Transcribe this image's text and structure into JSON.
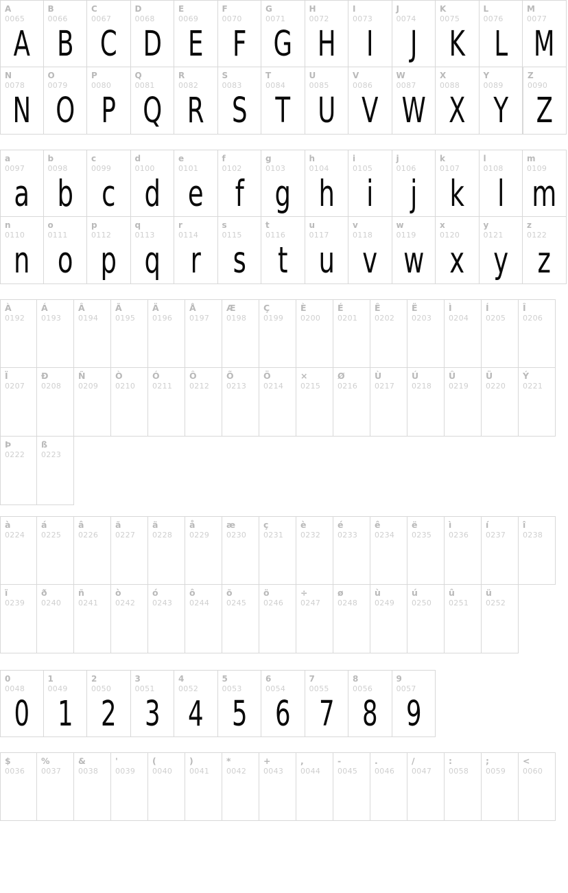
{
  "page": {
    "kind": "font-character-map",
    "background": "#ffffff",
    "grid_line_color": "#d8d8d8",
    "label_color": "#b9b9b9",
    "code_color": "#cfcfcf",
    "glyph_color": "#0a0a0a"
  },
  "sections": [
    {
      "id": "uppercase",
      "cell_style": "wide",
      "rows": [
        [
          {
            "ch": "A",
            "code": "0065",
            "rendered": true
          },
          {
            "ch": "B",
            "code": "0066",
            "rendered": true
          },
          {
            "ch": "C",
            "code": "0067",
            "rendered": true
          },
          {
            "ch": "D",
            "code": "0068",
            "rendered": true
          },
          {
            "ch": "E",
            "code": "0069",
            "rendered": true
          },
          {
            "ch": "F",
            "code": "0070",
            "rendered": true
          },
          {
            "ch": "G",
            "code": "0071",
            "rendered": true
          },
          {
            "ch": "H",
            "code": "0072",
            "rendered": true
          },
          {
            "ch": "I",
            "code": "0073",
            "rendered": true
          },
          {
            "ch": "J",
            "code": "0074",
            "rendered": true
          },
          {
            "ch": "K",
            "code": "0075",
            "rendered": true
          },
          {
            "ch": "L",
            "code": "0076",
            "rendered": true
          },
          {
            "ch": "M",
            "code": "0077",
            "rendered": true
          }
        ],
        [
          {
            "ch": "N",
            "code": "0078",
            "rendered": true
          },
          {
            "ch": "O",
            "code": "0079",
            "rendered": true
          },
          {
            "ch": "P",
            "code": "0080",
            "rendered": true
          },
          {
            "ch": "Q",
            "code": "0081",
            "rendered": true
          },
          {
            "ch": "R",
            "code": "0082",
            "rendered": true
          },
          {
            "ch": "S",
            "code": "0083",
            "rendered": true
          },
          {
            "ch": "T",
            "code": "0084",
            "rendered": true
          },
          {
            "ch": "U",
            "code": "0085",
            "rendered": true
          },
          {
            "ch": "V",
            "code": "0086",
            "rendered": true
          },
          {
            "ch": "W",
            "code": "0087",
            "rendered": true
          },
          {
            "ch": "X",
            "code": "0088",
            "rendered": true
          },
          {
            "ch": "Y",
            "code": "0089",
            "rendered": true
          }
        ],
        [
          {
            "ch": "Z",
            "code": "0090",
            "rendered": true
          }
        ]
      ]
    },
    {
      "id": "lowercase",
      "cell_style": "wide",
      "rows": [
        [
          {
            "ch": "a",
            "code": "0097",
            "rendered": true
          },
          {
            "ch": "b",
            "code": "0098",
            "rendered": true
          },
          {
            "ch": "c",
            "code": "0099",
            "rendered": true
          },
          {
            "ch": "d",
            "code": "0100",
            "rendered": true
          },
          {
            "ch": "e",
            "code": "0101",
            "rendered": true
          },
          {
            "ch": "f",
            "code": "0102",
            "rendered": true
          },
          {
            "ch": "g",
            "code": "0103",
            "rendered": true
          },
          {
            "ch": "h",
            "code": "0104",
            "rendered": true
          },
          {
            "ch": "i",
            "code": "0105",
            "rendered": true
          },
          {
            "ch": "j",
            "code": "0106",
            "rendered": true
          },
          {
            "ch": "k",
            "code": "0107",
            "rendered": true
          },
          {
            "ch": "l",
            "code": "0108",
            "rendered": true
          },
          {
            "ch": "m",
            "code": "0109",
            "rendered": true
          }
        ],
        [
          {
            "ch": "n",
            "code": "0110",
            "rendered": true
          },
          {
            "ch": "o",
            "code": "0111",
            "rendered": true
          },
          {
            "ch": "p",
            "code": "0112",
            "rendered": true
          },
          {
            "ch": "q",
            "code": "0113",
            "rendered": true
          },
          {
            "ch": "r",
            "code": "0114",
            "rendered": true
          },
          {
            "ch": "s",
            "code": "0115",
            "rendered": true
          },
          {
            "ch": "t",
            "code": "0116",
            "rendered": true
          },
          {
            "ch": "u",
            "code": "0117",
            "rendered": true
          },
          {
            "ch": "v",
            "code": "0118",
            "rendered": true
          },
          {
            "ch": "w",
            "code": "0119",
            "rendered": true
          },
          {
            "ch": "x",
            "code": "0120",
            "rendered": true
          },
          {
            "ch": "y",
            "code": "0121",
            "rendered": true
          },
          {
            "ch": "z",
            "code": "0122",
            "rendered": true
          }
        ]
      ]
    },
    {
      "id": "accented-uppercase",
      "cell_style": "narrow",
      "rows": [
        [
          {
            "ch": "À",
            "code": "0192",
            "rendered": false
          },
          {
            "ch": "Á",
            "code": "0193",
            "rendered": false
          },
          {
            "ch": "Â",
            "code": "0194",
            "rendered": false
          },
          {
            "ch": "Ã",
            "code": "0195",
            "rendered": false
          },
          {
            "ch": "Ä",
            "code": "0196",
            "rendered": false
          },
          {
            "ch": "Å",
            "code": "0197",
            "rendered": false
          },
          {
            "ch": "Æ",
            "code": "0198",
            "rendered": false
          },
          {
            "ch": "Ç",
            "code": "0199",
            "rendered": false
          },
          {
            "ch": "È",
            "code": "0200",
            "rendered": false
          },
          {
            "ch": "É",
            "code": "0201",
            "rendered": false
          },
          {
            "ch": "Ê",
            "code": "0202",
            "rendered": false
          },
          {
            "ch": "Ë",
            "code": "0203",
            "rendered": false
          },
          {
            "ch": "Ì",
            "code": "0204",
            "rendered": false
          },
          {
            "ch": "Í",
            "code": "0205",
            "rendered": false
          },
          {
            "ch": "Î",
            "code": "0206",
            "rendered": false
          }
        ],
        [
          {
            "ch": "Ï",
            "code": "0207",
            "rendered": false
          },
          {
            "ch": "Ð",
            "code": "0208",
            "rendered": false
          },
          {
            "ch": "Ñ",
            "code": "0209",
            "rendered": false
          },
          {
            "ch": "Ò",
            "code": "0210",
            "rendered": false
          },
          {
            "ch": "Ó",
            "code": "0211",
            "rendered": false
          },
          {
            "ch": "Ô",
            "code": "0212",
            "rendered": false
          },
          {
            "ch": "Õ",
            "code": "0213",
            "rendered": false
          },
          {
            "ch": "Ö",
            "code": "0214",
            "rendered": false
          },
          {
            "ch": "×",
            "code": "0215",
            "rendered": false
          },
          {
            "ch": "Ø",
            "code": "0216",
            "rendered": false
          },
          {
            "ch": "Ù",
            "code": "0217",
            "rendered": false
          },
          {
            "ch": "Ú",
            "code": "0218",
            "rendered": false
          },
          {
            "ch": "Û",
            "code": "0219",
            "rendered": false
          },
          {
            "ch": "Ü",
            "code": "0220",
            "rendered": false
          },
          {
            "ch": "Ý",
            "code": "0221",
            "rendered": false
          }
        ],
        [
          {
            "ch": "Þ",
            "code": "0222",
            "rendered": false
          },
          {
            "ch": "ß",
            "code": "0223",
            "rendered": false
          }
        ]
      ]
    },
    {
      "id": "accented-lowercase",
      "cell_style": "narrow",
      "rows": [
        [
          {
            "ch": "à",
            "code": "0224",
            "rendered": false
          },
          {
            "ch": "á",
            "code": "0225",
            "rendered": false
          },
          {
            "ch": "â",
            "code": "0226",
            "rendered": false
          },
          {
            "ch": "ã",
            "code": "0227",
            "rendered": false
          },
          {
            "ch": "ä",
            "code": "0228",
            "rendered": false
          },
          {
            "ch": "å",
            "code": "0229",
            "rendered": false
          },
          {
            "ch": "æ",
            "code": "0230",
            "rendered": false
          },
          {
            "ch": "ç",
            "code": "0231",
            "rendered": false
          },
          {
            "ch": "è",
            "code": "0232",
            "rendered": false
          },
          {
            "ch": "é",
            "code": "0233",
            "rendered": false
          },
          {
            "ch": "ê",
            "code": "0234",
            "rendered": false
          },
          {
            "ch": "ë",
            "code": "0235",
            "rendered": false
          },
          {
            "ch": "ì",
            "code": "0236",
            "rendered": false
          },
          {
            "ch": "í",
            "code": "0237",
            "rendered": false
          },
          {
            "ch": "î",
            "code": "0238",
            "rendered": false
          }
        ],
        [
          {
            "ch": "ï",
            "code": "0239",
            "rendered": false
          },
          {
            "ch": "ð",
            "code": "0240",
            "rendered": false
          },
          {
            "ch": "ñ",
            "code": "0241",
            "rendered": false
          },
          {
            "ch": "ò",
            "code": "0242",
            "rendered": false
          },
          {
            "ch": "ó",
            "code": "0243",
            "rendered": false
          },
          {
            "ch": "ô",
            "code": "0244",
            "rendered": false
          },
          {
            "ch": "õ",
            "code": "0245",
            "rendered": false
          },
          {
            "ch": "ö",
            "code": "0246",
            "rendered": false
          },
          {
            "ch": "÷",
            "code": "0247",
            "rendered": false
          },
          {
            "ch": "ø",
            "code": "0248",
            "rendered": false
          },
          {
            "ch": "ù",
            "code": "0249",
            "rendered": false
          },
          {
            "ch": "ú",
            "code": "0250",
            "rendered": false
          },
          {
            "ch": "û",
            "code": "0251",
            "rendered": false
          },
          {
            "ch": "ü",
            "code": "0252",
            "rendered": false
          }
        ]
      ]
    },
    {
      "id": "digits",
      "cell_style": "wide",
      "rows": [
        [
          {
            "ch": "0",
            "code": "0048",
            "rendered": true
          },
          {
            "ch": "1",
            "code": "0049",
            "rendered": true
          },
          {
            "ch": "2",
            "code": "0050",
            "rendered": true
          },
          {
            "ch": "3",
            "code": "0051",
            "rendered": true
          },
          {
            "ch": "4",
            "code": "0052",
            "rendered": true
          },
          {
            "ch": "5",
            "code": "0053",
            "rendered": true
          },
          {
            "ch": "6",
            "code": "0054",
            "rendered": true
          },
          {
            "ch": "7",
            "code": "0055",
            "rendered": true
          },
          {
            "ch": "8",
            "code": "0056",
            "rendered": true
          },
          {
            "ch": "9",
            "code": "0057",
            "rendered": true
          }
        ]
      ]
    },
    {
      "id": "punctuation",
      "cell_style": "narrow",
      "rows": [
        [
          {
            "ch": "$",
            "code": "0036",
            "rendered": false
          },
          {
            "ch": "%",
            "code": "0037",
            "rendered": false
          },
          {
            "ch": "&",
            "code": "0038",
            "rendered": false
          },
          {
            "ch": "'",
            "code": "0039",
            "rendered": false
          },
          {
            "ch": "(",
            "code": "0040",
            "rendered": false
          },
          {
            "ch": ")",
            "code": "0041",
            "rendered": false
          },
          {
            "ch": "*",
            "code": "0042",
            "rendered": false
          },
          {
            "ch": "+",
            "code": "0043",
            "rendered": false
          },
          {
            "ch": ",",
            "code": "0044",
            "rendered": false
          },
          {
            "ch": "-",
            "code": "0045",
            "rendered": false
          },
          {
            "ch": ".",
            "code": "0046",
            "rendered": false
          },
          {
            "ch": "/",
            "code": "0047",
            "rendered": false
          },
          {
            "ch": ":",
            "code": "0058",
            "rendered": false
          },
          {
            "ch": ";",
            "code": "0059",
            "rendered": false
          },
          {
            "ch": "<",
            "code": "0060",
            "rendered": false
          }
        ]
      ]
    }
  ]
}
